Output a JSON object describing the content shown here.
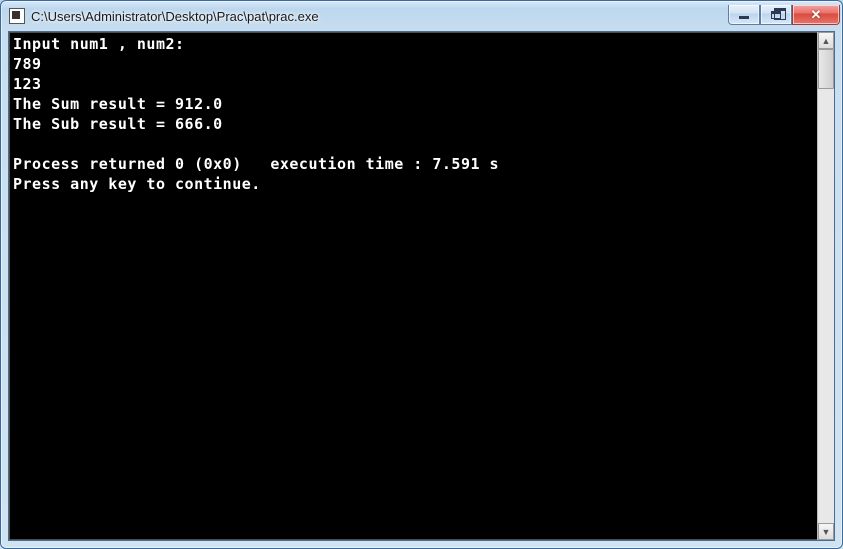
{
  "window": {
    "title": "C:\\Users\\Administrator\\Desktop\\Prac\\pat\\prac.exe"
  },
  "console": {
    "lines": [
      "Input num1 , num2:",
      "789",
      "123",
      "The Sum result = 912.0",
      "The Sub result = 666.0",
      "",
      "Process returned 0 (0x0)   execution time : 7.591 s",
      "Press any key to continue."
    ]
  },
  "scrollbar": {
    "up": "▲",
    "down": "▼"
  }
}
